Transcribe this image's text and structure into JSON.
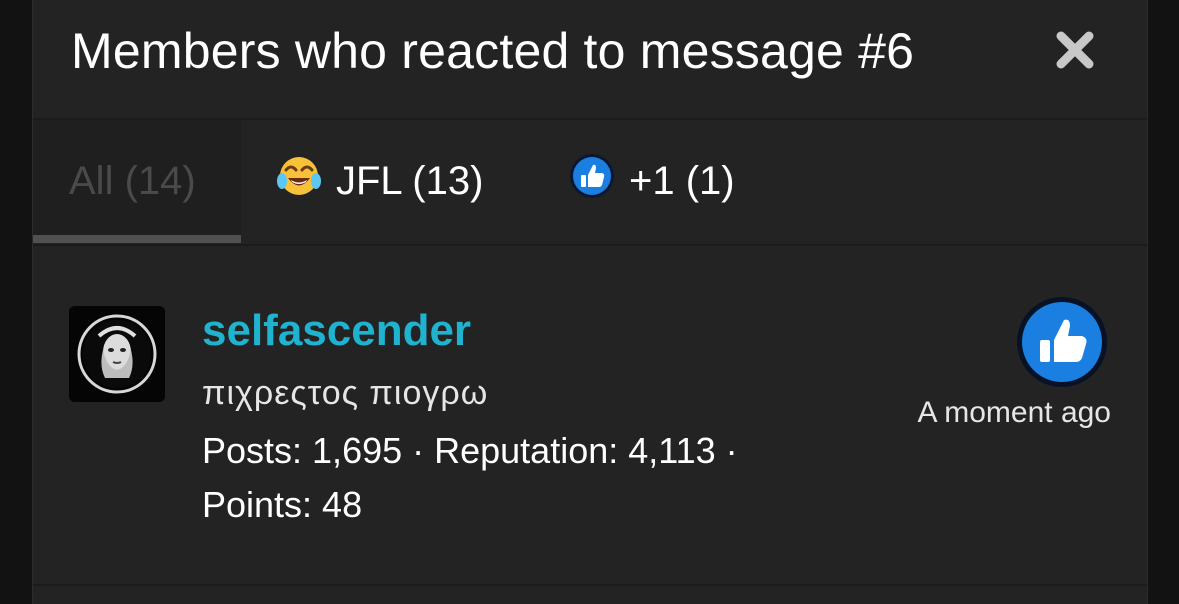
{
  "modal": {
    "title": "Members who reacted to message #6"
  },
  "tabs": [
    {
      "label": "All (14)",
      "icon": null,
      "active": true
    },
    {
      "label": "JFL (13)",
      "icon": "laughing-crying-emoji-icon",
      "active": false
    },
    {
      "label": "+1 (1)",
      "icon": "thumbs-up-icon",
      "active": false
    }
  ],
  "members": [
    {
      "username": "selfascender",
      "title": "πιχρεςτος πιογρω",
      "stats_line1": "Posts: 1,695 · Reputation: 4,113 ·",
      "stats_line2": "Points: 48",
      "reaction_icon": "thumbs-up-icon",
      "reaction_time": "A moment ago"
    }
  ],
  "colors": {
    "username": "#1fb3cf",
    "reaction_blue": "#1a7fe0",
    "background": "#232323"
  }
}
